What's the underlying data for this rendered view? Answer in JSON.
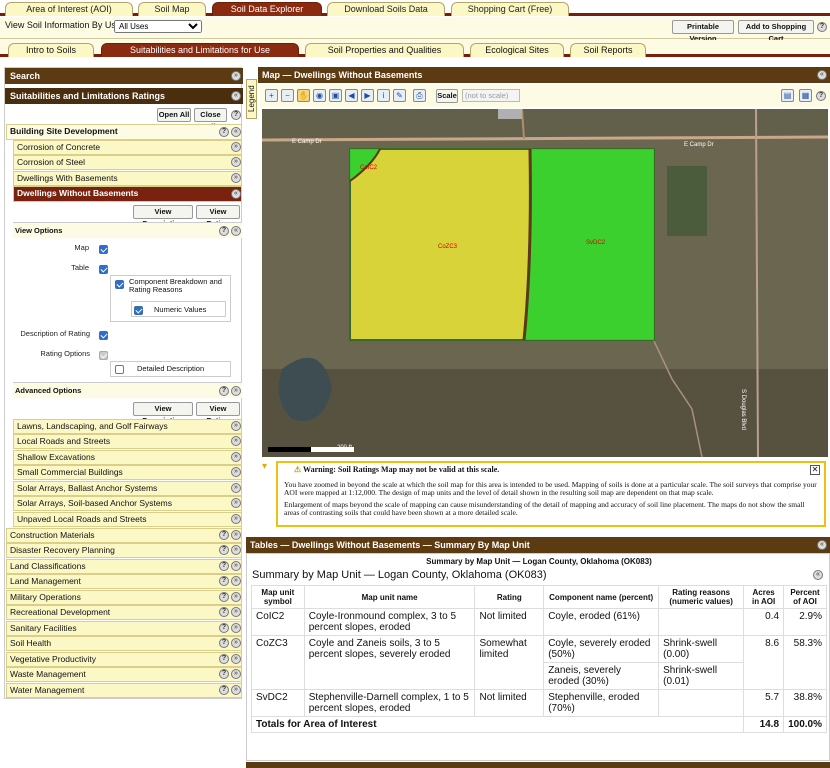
{
  "top_tabs": [
    "Area of Interest (AOI)",
    "Soil Map",
    "Soil Data Explorer",
    "Download Soils Data",
    "Shopping Cart (Free)"
  ],
  "info": {
    "label": "View Soil Information By Use:",
    "select_value": "All Uses",
    "printable": "Printable Version",
    "add_cart": "Add to Shopping Cart"
  },
  "sub_tabs": [
    "Intro to Soils",
    "Suitabilities and Limitations for Use",
    "Soil Properties and Qualities",
    "Ecological Sites",
    "Soil Reports"
  ],
  "left": {
    "search": "Search",
    "ratings_title": "Suitabilities and Limitations Ratings",
    "open_all": "Open All",
    "close_all": "Close All",
    "building": "Building Site Development",
    "building_items": [
      "Corrosion of Concrete",
      "Corrosion of Steel",
      "Dwellings With Basements"
    ],
    "active_item": "Dwellings Without Basements",
    "view_desc": "View Description",
    "view_rating": "View Rating",
    "view_options": "View Options",
    "opt_map": "Map",
    "opt_table": "Table",
    "opt_component": "Component Breakdown and Rating Reasons",
    "opt_numeric": "Numeric Values",
    "opt_desc": "Description of Rating",
    "opt_rating": "Rating Options",
    "opt_detailed": "Detailed Description",
    "advanced": "Advanced Options",
    "more_items": [
      "Lawns, Landscaping, and Golf Fairways",
      "Local Roads and Streets",
      "Shallow Excavations",
      "Small Commercial Buildings",
      "Solar Arrays, Ballast Anchor Systems",
      "Solar Arrays, Soil-based Anchor Systems",
      "Unpaved Local Roads and Streets"
    ],
    "categories": [
      "Construction Materials",
      "Disaster Recovery Planning",
      "Land Classifications",
      "Land Management",
      "Military Operations",
      "Recreational Development",
      "Sanitary Facilities",
      "Soil Health",
      "Vegetative Productivity",
      "Waste Management",
      "Water Management"
    ]
  },
  "map": {
    "title": "Map — Dwellings Without Basements",
    "legend": "Legend",
    "scale_btn": "Scale",
    "scale_select": "(not to scale)",
    "road1": "E Camp Dr",
    "road2": "E Camp Dr",
    "road3": "S Douglas Blvd",
    "unit1": "CoIC2",
    "unit2": "CoZC3",
    "unit3": "SvDC2",
    "scalebar": "200 ft",
    "color_limited": "#2fcf2f",
    "color_somewhat": "#e6e236"
  },
  "warning": {
    "title": "Warning: Soil Ratings Map may not be valid at this scale.",
    "p1": "You have zoomed in beyond the scale at which the soil map for this area is intended to be used. Mapping of soils is done at a particular scale. The soil surveys that comprise your AOI were mapped at 1:12,000. The design of map units and the level of detail shown in the resulting soil map are dependent on that map scale.",
    "p2": "Enlargement of maps beyond the scale of mapping can cause misunderstanding of the detail of mapping and accuracy of soil line placement. The maps do not show the small areas of contrasting soils that could have been shown at a more detailed scale."
  },
  "tables": {
    "title": "Tables — Dwellings Without Basements — Summary By Map Unit",
    "caption": "Summary by Map Unit — Logan County, Oklahoma (OK083)",
    "heading": "Summary by Map Unit — Logan County, Oklahoma (OK083)",
    "headers": [
      "Map unit symbol",
      "Map unit name",
      "Rating",
      "Component name (percent)",
      "Rating reasons (numeric values)",
      "Acres in AOI",
      "Percent of AOI"
    ],
    "rows": [
      {
        "sym": "CoIC2",
        "name": "Coyle-Ironmound complex, 3 to 5 percent slopes, eroded",
        "rating": "Not limited",
        "comp": "Coyle, eroded (61%)",
        "reason": "",
        "acres": "0.4",
        "pct": "2.9%"
      },
      {
        "sym": "CoZC3",
        "name": "Coyle and Zaneis soils, 3 to 5 percent slopes, severely eroded",
        "rating": "Somewhat limited",
        "comp": "Coyle, severely eroded (50%)",
        "reason": "Shrink-swell (0.00)",
        "acres": "8.6",
        "pct": "58.3%"
      },
      {
        "sym": "",
        "name": "",
        "rating": "",
        "comp": "Zaneis, severely eroded (30%)",
        "reason": "Shrink-swell (0.01)",
        "acres": "",
        "pct": ""
      },
      {
        "sym": "SvDC2",
        "name": "Stephenville-Darnell complex, 1 to 5 percent slopes, eroded",
        "rating": "Not limited",
        "comp": "Stephenville, eroded (70%)",
        "reason": "",
        "acres": "5.7",
        "pct": "38.8%"
      }
    ],
    "totals_label": "Totals for Area of Interest",
    "total_acres": "14.8",
    "total_pct": "100.0%"
  }
}
